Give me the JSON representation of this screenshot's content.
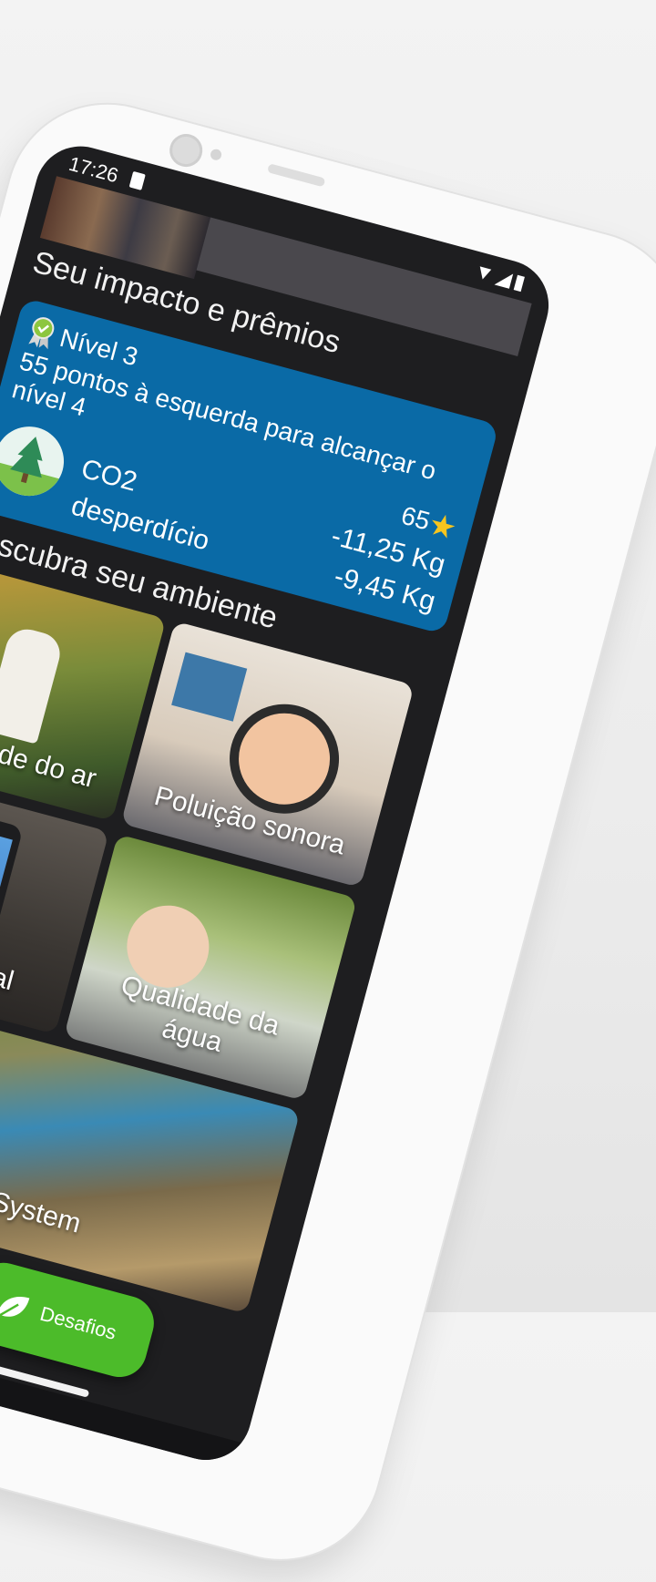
{
  "status_bar": {
    "time": "17:26",
    "icons": "▼◢▮"
  },
  "sections": {
    "impact_title": "Seu impacto e prêmios",
    "discover_title": "Descubra seu ambiente"
  },
  "impact_card": {
    "level": "Nível 3",
    "points_text": "55 pontos à esquerda para alcançar o nível 4",
    "stars": "65",
    "metrics": [
      {
        "label": "CO2",
        "value": "-11,25 Kg"
      },
      {
        "label": "desperdício",
        "value": "-9,45 Kg"
      }
    ]
  },
  "tiles": [
    {
      "label": "Qualidade do ar"
    },
    {
      "label": "Poluição sonora"
    },
    {
      "label": "Mídia Social"
    },
    {
      "label": "Qualidade da água"
    },
    {
      "label": "EcoSystem"
    }
  ],
  "fab": {
    "label": "Desafios"
  },
  "colors": {
    "card": "#0a6aa6",
    "fab": "#4cbb2a",
    "screen_bg": "#1e1e20"
  }
}
